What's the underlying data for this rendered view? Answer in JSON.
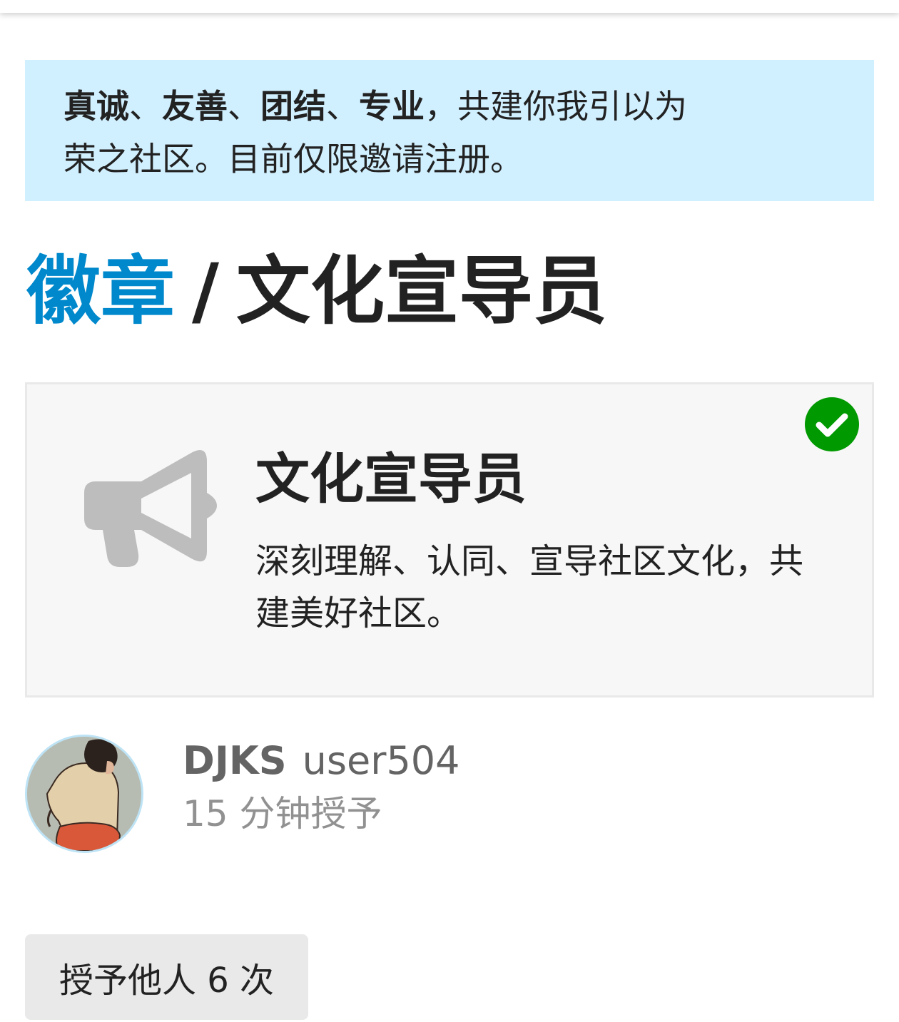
{
  "banner": {
    "strong_1": "真诚",
    "sep_1": "、",
    "strong_2": "友善",
    "sep_2": "、",
    "strong_3": "团结",
    "sep_3": "、",
    "strong_4": "专业",
    "rest_line1": "，共建你我引以为",
    "rest_line2": "荣之社区。目前仅限邀请注册。"
  },
  "breadcrumb": {
    "parent": "徽章",
    "separator": "/",
    "current": "文化宣导员"
  },
  "badge": {
    "title": "文化宣导员",
    "description": "深刻理解、认同、宣导社区文化，共建美好社区。",
    "icon": "bullhorn-icon",
    "granted_icon": "check-circle-icon"
  },
  "grant": {
    "display_name": "DJKS",
    "username": "user504",
    "time": "15 分钟授予"
  },
  "action": {
    "grant_button_label": "授予他人 6 次"
  },
  "colors": {
    "link": "#0088cc",
    "banner_bg": "#d1f0ff",
    "check_green": "#009900",
    "icon_gray": "#bdbdbd",
    "card_bg": "#f7f7f7"
  }
}
